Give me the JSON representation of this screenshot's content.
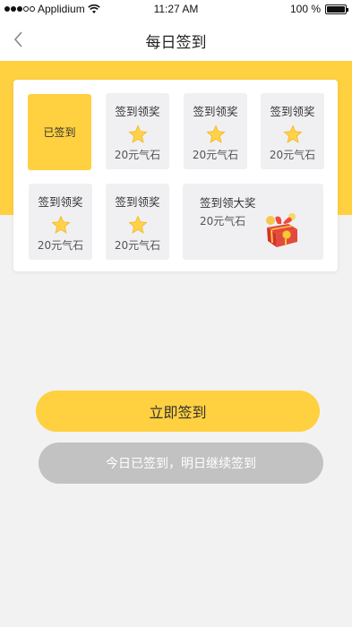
{
  "status_bar": {
    "carrier": "Applidium",
    "time": "11:27 AM",
    "battery": "100 %"
  },
  "nav": {
    "title": "每日签到",
    "back_icon": "chevron-left-icon"
  },
  "days": [
    {
      "state": "signed",
      "signed_label": "已签到"
    },
    {
      "state": "pending",
      "label": "签到领奖",
      "reward": "20元气石",
      "icon": "star-icon"
    },
    {
      "state": "pending",
      "label": "签到领奖",
      "reward": "20元气石",
      "icon": "star-icon"
    },
    {
      "state": "pending",
      "label": "签到领奖",
      "reward": "20元气石",
      "icon": "star-icon"
    },
    {
      "state": "pending",
      "label": "签到领奖",
      "reward": "20元气石",
      "icon": "star-icon"
    },
    {
      "state": "pending",
      "label": "签到领奖",
      "reward": "20元气石",
      "icon": "star-icon"
    }
  ],
  "big_prize": {
    "label": "签到领大奖",
    "reward": "20元气石",
    "icon": "gift-box-icon"
  },
  "buttons": {
    "sign_in": "立即签到",
    "signed_today": "今日已签到，明日继续签到"
  },
  "colors": {
    "accent": "#ffd040",
    "disabled": "#c2c2c2",
    "tile_bg": "#f0f0f2"
  }
}
